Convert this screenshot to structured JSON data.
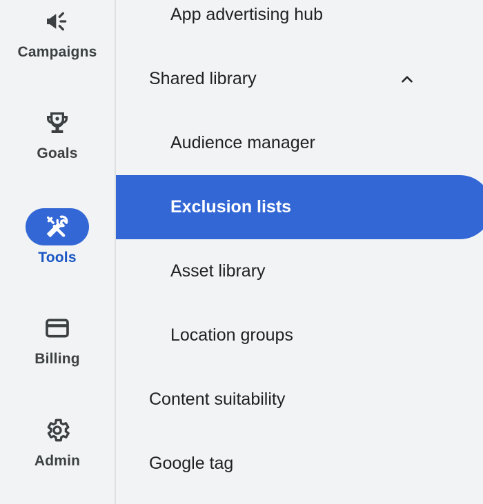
{
  "rail": {
    "items": [
      {
        "label": "Campaigns",
        "icon": "megaphone-icon"
      },
      {
        "label": "Goals",
        "icon": "trophy-icon"
      },
      {
        "label": "Tools",
        "icon": "tools-icon",
        "active": true
      },
      {
        "label": "Billing",
        "icon": "credit-card-icon"
      },
      {
        "label": "Admin",
        "icon": "gear-icon"
      }
    ]
  },
  "menu": {
    "app_advertising_hub": "App advertising hub",
    "shared_library": {
      "label": "Shared library",
      "expanded": true,
      "icon": "chevron-up-icon",
      "children": [
        {
          "label": "Audience manager"
        },
        {
          "label": "Exclusion lists",
          "selected": true
        },
        {
          "label": "Asset library"
        },
        {
          "label": "Location groups"
        }
      ]
    },
    "content_suitability": "Content suitability",
    "google_tag": "Google tag"
  },
  "colors": {
    "accent": "#3367d6",
    "active_label": "#1a56c4",
    "background": "#f1f3f4",
    "text": "#202124"
  }
}
